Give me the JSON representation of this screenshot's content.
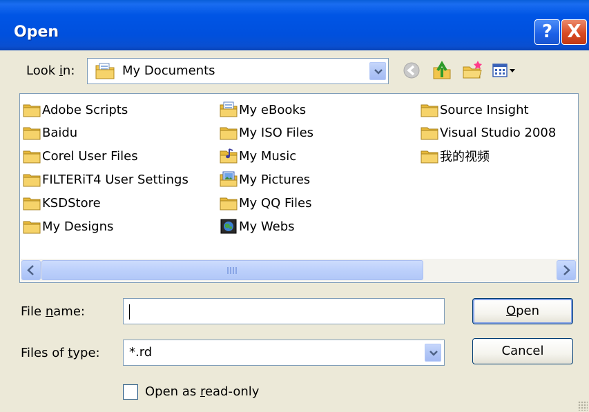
{
  "dialog": {
    "title": "Open",
    "help_glyph": "?",
    "close_glyph": "X"
  },
  "look_in": {
    "label_pre": "Look ",
    "label_accel": "i",
    "label_post": "n:",
    "value": "My Documents",
    "icon": "my-documents-icon"
  },
  "toolbar": {
    "back": "back-icon",
    "up": "up-folder-icon",
    "new_folder": "new-folder-icon",
    "views": "views-menu-icon"
  },
  "files": {
    "column1": [
      {
        "label": "Adobe Scripts",
        "icon": "folder-icon"
      },
      {
        "label": "Baidu",
        "icon": "folder-icon"
      },
      {
        "label": "Corel User Files",
        "icon": "folder-icon"
      },
      {
        "label": "FILTERiT4 User Settings",
        "icon": "folder-icon"
      },
      {
        "label": "KSDStore",
        "icon": "folder-icon"
      },
      {
        "label": "My Designs",
        "icon": "folder-icon"
      }
    ],
    "column2": [
      {
        "label": "My eBooks",
        "icon": "ebooks-folder-icon"
      },
      {
        "label": "My ISO Files",
        "icon": "folder-icon"
      },
      {
        "label": "My Music",
        "icon": "music-folder-icon"
      },
      {
        "label": "My Pictures",
        "icon": "pictures-folder-icon"
      },
      {
        "label": "My QQ Files",
        "icon": "folder-icon"
      },
      {
        "label": "My Webs",
        "icon": "webs-folder-icon"
      }
    ],
    "column3": [
      {
        "label": "Source Insight",
        "icon": "folder-icon"
      },
      {
        "label": "Visual Studio 2008",
        "icon": "folder-icon"
      },
      {
        "label": "我的视频",
        "icon": "folder-icon"
      }
    ]
  },
  "file_name": {
    "label_pre": "File ",
    "label_accel": "n",
    "label_post": "ame:",
    "value": ""
  },
  "file_type": {
    "label_pre": "Files of ",
    "label_accel": "t",
    "label_post": "ype:",
    "value": "*.rd"
  },
  "read_only": {
    "label_pre": "Open as ",
    "label_accel": "r",
    "label_post": "ead-only",
    "checked": false
  },
  "buttons": {
    "open_accel": "O",
    "open_rest": "pen",
    "cancel": "Cancel"
  },
  "colors": {
    "titlebar": "#0055e5",
    "dialog_bg": "#ece9d8",
    "folder": "#f2c54c",
    "border": "#7f9db9"
  }
}
